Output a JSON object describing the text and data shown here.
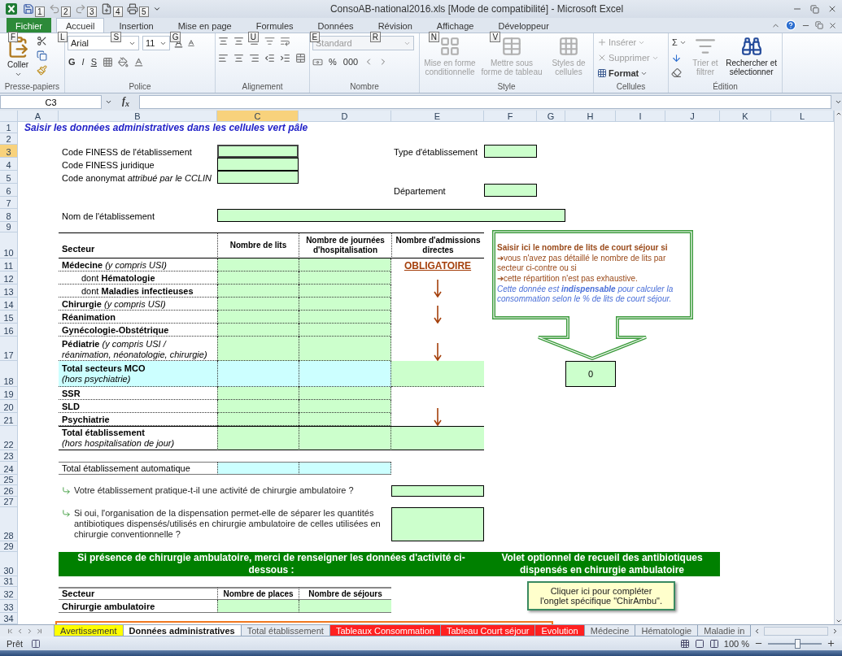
{
  "window": {
    "title": "ConsoAB-national2016.xls [Mode de compatibilité] - Microsoft Excel"
  },
  "quick_access": [
    {
      "kind": "save",
      "keytip": "1"
    },
    {
      "kind": "undo",
      "keytip": "2"
    },
    {
      "kind": "redo",
      "keytip": "3"
    },
    {
      "kind": "new",
      "keytip": "4"
    },
    {
      "kind": "print",
      "keytip": "5"
    }
  ],
  "ribbon_tabs": [
    {
      "label": "Fichier",
      "keytip": "F",
      "kind": "file",
      "selected": false
    },
    {
      "label": "Accueil",
      "keytip": "L",
      "kind": "tab",
      "selected": true
    },
    {
      "label": "Insertion",
      "keytip": "S",
      "kind": "tab",
      "selected": false
    },
    {
      "label": "Mise en page",
      "keytip": "G",
      "kind": "tab",
      "selected": false
    },
    {
      "label": "Formules",
      "keytip": "U",
      "kind": "tab",
      "selected": false
    },
    {
      "label": "Données",
      "keytip": "E",
      "kind": "tab",
      "selected": false
    },
    {
      "label": "Révision",
      "keytip": "R",
      "kind": "tab",
      "selected": false
    },
    {
      "label": "Affichage",
      "keytip": "N",
      "kind": "tab",
      "selected": false
    },
    {
      "label": "Développeur",
      "keytip": "V",
      "kind": "tab",
      "selected": false
    }
  ],
  "ribbon": {
    "groups": [
      {
        "kind": "clipboard",
        "label": "Presse-papiers",
        "paste": "Coller"
      },
      {
        "kind": "font",
        "label": "Police",
        "font": "Arial",
        "size": "11",
        "bold": "G",
        "italic": "I",
        "underline": "S"
      },
      {
        "kind": "alignment",
        "label": "Alignement"
      },
      {
        "kind": "number",
        "label": "Nombre",
        "format": {
          "value": "Standard",
          "disabled": true
        },
        "percent": "%",
        "thousands": "000"
      },
      {
        "kind": "style",
        "label": "Style",
        "buttons": [
          {
            "label": "Mise en forme conditionnelle",
            "disabled": true
          },
          {
            "label": "Mettre sous forme de tableau",
            "disabled": true
          },
          {
            "label": "Styles de cellules",
            "disabled": true
          }
        ]
      },
      {
        "kind": "cells",
        "label": "Cellules",
        "buttons": [
          {
            "label": "Insérer",
            "disabled": true
          },
          {
            "label": "Supprimer",
            "disabled": true
          },
          {
            "label": "Format",
            "disabled": false
          }
        ]
      },
      {
        "kind": "editing",
        "label": "Édition",
        "sum": "Σ",
        "buttons": [
          {
            "label": "Trier et filtrer",
            "disabled": true
          },
          {
            "label": "Rechercher et sélectionner",
            "disabled": false
          }
        ]
      }
    ]
  },
  "formula_bar": {
    "name_box": "C3",
    "fx": "f$_{x}$"
  },
  "column_headers": [
    {
      "label": "A",
      "selected": false
    },
    {
      "label": "B",
      "selected": false
    },
    {
      "label": "C",
      "selected": true
    },
    {
      "label": "D",
      "selected": false
    },
    {
      "label": "E",
      "selected": false
    },
    {
      "label": "F",
      "selected": false
    },
    {
      "label": "G",
      "selected": false
    },
    {
      "label": "H",
      "selected": false
    },
    {
      "label": "I",
      "selected": false
    },
    {
      "label": "J",
      "selected": false
    },
    {
      "label": "K",
      "selected": false
    },
    {
      "label": "L",
      "selected": false
    }
  ],
  "row_headers": [
    {
      "label": "1",
      "selected": false
    },
    {
      "label": "2",
      "selected": false
    },
    {
      "label": "3",
      "selected": true
    },
    {
      "label": "4",
      "selected": false
    },
    {
      "label": "5",
      "selected": false
    },
    {
      "label": "6",
      "selected": false
    },
    {
      "label": "7",
      "selected": false
    },
    {
      "label": "8",
      "selected": false
    },
    {
      "label": "9",
      "selected": false
    },
    {
      "label": "10",
      "selected": false
    },
    {
      "label": "11",
      "selected": false
    },
    {
      "label": "12",
      "selected": false
    },
    {
      "label": "13",
      "selected": false
    },
    {
      "label": "14",
      "selected": false
    },
    {
      "label": "15",
      "selected": false
    },
    {
      "label": "16",
      "selected": false
    },
    {
      "label": "17",
      "selected": false
    },
    {
      "label": "18",
      "selected": false
    },
    {
      "label": "19",
      "selected": false
    },
    {
      "label": "20",
      "selected": false
    },
    {
      "label": "21",
      "selected": false
    },
    {
      "label": "22",
      "selected": false
    },
    {
      "label": "23",
      "selected": false
    },
    {
      "label": "24",
      "selected": false
    },
    {
      "label": "25",
      "selected": false
    },
    {
      "label": "26",
      "selected": false
    },
    {
      "label": "27",
      "selected": false
    },
    {
      "label": "28",
      "selected": false
    },
    {
      "label": "29",
      "selected": false
    },
    {
      "label": "30",
      "selected": false
    },
    {
      "label": "31",
      "selected": false
    },
    {
      "label": "32",
      "selected": false
    },
    {
      "label": "33",
      "selected": false
    },
    {
      "label": "34",
      "selected": false
    }
  ],
  "sheet": {
    "title": "Saisir les données administratives dans les cellules vert pâle",
    "id_fields": [
      {
        "label": "Code FINESS de l'établissement",
        "selected": true
      },
      {
        "label": "Code FINESS juridique",
        "selected": false
      },
      {
        "label": "Code anonymat *attribué par le CCLIN*",
        "selected": false
      }
    ],
    "side_fields": [
      {
        "label": "Type d'établissement"
      },
      {
        "label": "Département"
      }
    ],
    "name_field": {
      "label": "Nom de l'établissement"
    },
    "beds_table": {
      "columns": [
        "Secteur",
        "Nombre de lits",
        "Nombre de journées d'hospitalisation",
        "Nombre d'admissions directes"
      ],
      "rows": [
        {
          "label": "Médecine",
          "note": "(y compris USI)",
          "kind": "sector",
          "marker": {
            "kind": "label",
            "text": "OBLIGATOIRE"
          }
        },
        {
          "prefix": "dont",
          "label": "Hématologie",
          "kind": "sub"
        },
        {
          "prefix": "dont",
          "label": "Maladies infectieuses",
          "kind": "sub",
          "marker": {
            "kind": "arrow"
          }
        },
        {
          "label": "Chirurgie",
          "note": "(y compris USI)",
          "kind": "sector"
        },
        {
          "label": "Réanimation",
          "kind": "sector",
          "marker": {
            "kind": "arrow"
          }
        },
        {
          "label": "Gynécologie-Obstétrique",
          "kind": "sector"
        },
        {
          "label": "Pédiatrie",
          "note": "(y compris USI / réanimation, néonatologie, chirurgie)",
          "kind": "sector",
          "marker": {
            "kind": "arrow"
          }
        },
        {
          "label": "Total secteurs MCO",
          "note": "(hors psychiatrie)",
          "kind": "mco"
        },
        {
          "label": "SSR",
          "kind": "sector"
        },
        {
          "label": "SLD",
          "kind": "sector"
        },
        {
          "label": "Psychiatrie",
          "kind": "sector",
          "marker": {
            "kind": "arrow"
          }
        },
        {
          "label": "Total établissement",
          "note": "(hors hospitalisation de jour)",
          "kind": "total"
        }
      ]
    },
    "callout": [
      {
        "kind": "heading",
        "text": "Saisir ici le nombre de lits de court séjour si"
      },
      {
        "kind": "bullet",
        "text": "➔vous n'avez pas détaillé le nombre de lits par secteur ci-contre ou si"
      },
      {
        "kind": "bullet",
        "text": "➔cette répartition n'est pas exhaustive."
      },
      {
        "kind": "note",
        "text": "Cette donnée est **indispensable** pour calculer la consommation selon le % de lits de court séjour."
      }
    ],
    "court_sejour_value": "0",
    "total_auto": {
      "label": "Total établissement automatique"
    },
    "questions": [
      {
        "text": "Votre établissement pratique-t-il une activité de chirurgie ambulatoire ?"
      },
      {
        "text": "Si oui, l'organisation de la dispensation permet-elle de séparer les quantités antibiotiques dispensés/utilisés en chirurgie ambulatoire de celles utilisées en chirurgie conventionnelle ?"
      }
    ],
    "banners": [
      "Si présence de chirurgie ambulatoire, merci de renseigner les données d'activité ci-dessous :",
      "Volet optionnel de recueil des antibiotiques dispensés en chirurgie ambulatoire"
    ],
    "ambu_table": {
      "columns": [
        "Secteur",
        "Nombre de places",
        "Nombre de séjours"
      ],
      "rows": [
        {
          "label": "Chirurgie ambulatoire"
        }
      ]
    },
    "chirambu_button": "Cliquer ici pour compléter l'onglet spécifique \"ChirAmbu\"."
  },
  "sheet_tabs": [
    {
      "label": "Avertissement",
      "color": "#ffff00",
      "selected": false
    },
    {
      "label": "Données administratives",
      "selected": true
    },
    {
      "label": "Total établissement",
      "selected": false
    },
    {
      "label": "Tableaux Consommation",
      "color": "#ff2020",
      "selected": false
    },
    {
      "label": "Tableau Court séjour",
      "color": "#ff2020",
      "selected": false
    },
    {
      "label": "Evolution",
      "color": "#ff2020",
      "selected": false
    },
    {
      "label": "Médecine",
      "selected": false
    },
    {
      "label": "Hématologie",
      "selected": false
    },
    {
      "label": "Maladie in",
      "selected": false
    }
  ],
  "status_bar": {
    "status": "Prêt",
    "zoom": "100 %",
    "zoom_slider": {
      "level": 0.55
    }
  }
}
